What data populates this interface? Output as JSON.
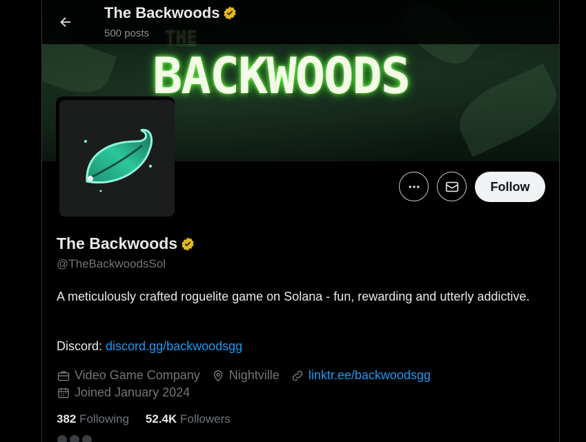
{
  "header": {
    "name": "The Backwoods",
    "post_count": "500 posts"
  },
  "banner": {
    "title": "BACKWOODS",
    "subtitle": "THE"
  },
  "actions": {
    "follow_label": "Follow"
  },
  "profile": {
    "display_name": "The Backwoods",
    "handle": "@TheBackwoodsSol",
    "bio": "A meticulously crafted roguelite game on Solana - fun, rewarding and utterly addictive.",
    "discord_label": "Discord:",
    "discord_link": "discord.gg/backwoodsgg",
    "category": "Video Game Company",
    "location": "Nightville",
    "website": "linktr.ee/backwoodsgg",
    "joined": "Joined January 2024",
    "following_count": "382",
    "following_label": "Following",
    "followers_count": "52.4K",
    "followers_label": "Followers"
  },
  "colors": {
    "verified": "#e2b719",
    "link": "#1d9bf0",
    "muted": "#71767b",
    "follow_bg": "#eff3f4"
  },
  "icons": {
    "back": "arrow-left-icon",
    "more": "more-dots-icon",
    "message": "envelope-icon",
    "verified": "verified-badge-icon",
    "category": "briefcase-icon",
    "location": "location-pin-icon",
    "website": "link-icon",
    "joined": "calendar-icon"
  }
}
